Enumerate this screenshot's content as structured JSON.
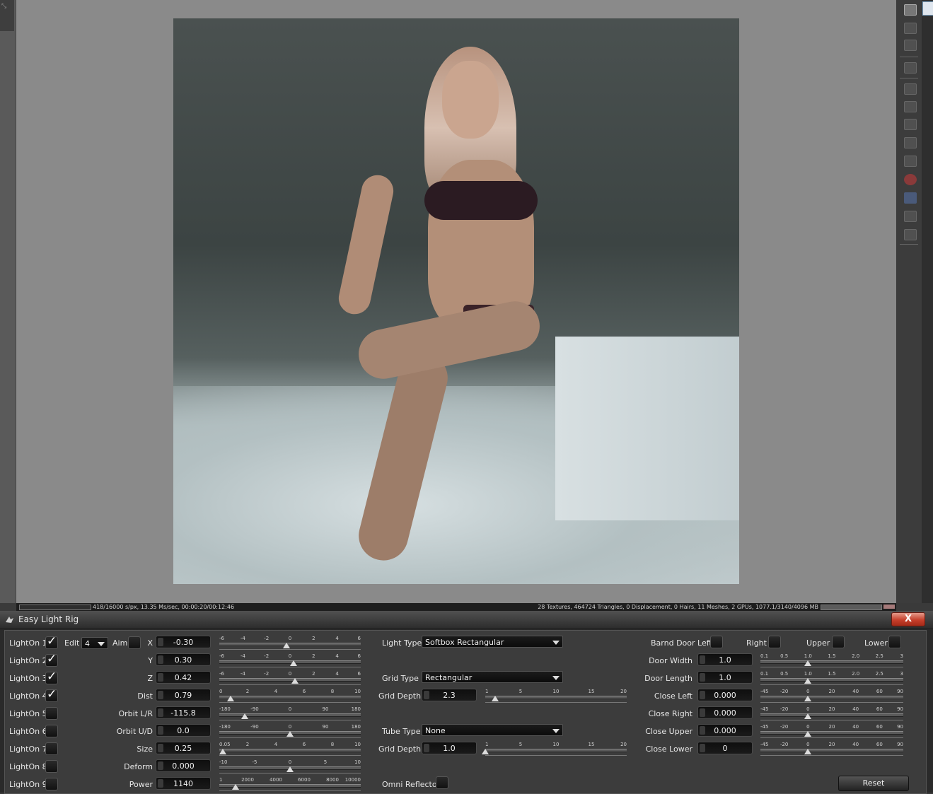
{
  "statusbar": {
    "render_stats": "418/16000 s/px, 13.35 Ms/sec, 00:00:20/00:12:46",
    "scene_stats": "28 Textures, 464724 Triangles, 0 Displacement, 0 Hairs, 11 Meshes, 2 GPUs, 1077.1/3140/4096 MB"
  },
  "dialog": {
    "title": "Easy Light Rig",
    "close_label": "X"
  },
  "lights": [
    {
      "label": "LightOn 1",
      "on": true
    },
    {
      "label": "LightOn 2",
      "on": true
    },
    {
      "label": "LightOn 3",
      "on": true
    },
    {
      "label": "LightOn 4",
      "on": true
    },
    {
      "label": "LightOn 5",
      "on": false
    },
    {
      "label": "LightOn 6",
      "on": false
    },
    {
      "label": "LightOn 7",
      "on": false
    },
    {
      "label": "LightOn 8",
      "on": false
    },
    {
      "label": "LightOn 9",
      "on": false
    }
  ],
  "edit": {
    "label": "Edit",
    "value": "4"
  },
  "aim": {
    "label": "Aim"
  },
  "params": {
    "x": {
      "label": "X",
      "value": "-0.30",
      "ticks": [
        "-6",
        "-4",
        "-2",
        "0",
        "2",
        "4",
        "6"
      ],
      "min": -6,
      "max": 6,
      "pos": -0.3
    },
    "y": {
      "label": "Y",
      "value": "0.30",
      "ticks": [
        "-6",
        "-4",
        "-2",
        "0",
        "2",
        "4",
        "6"
      ],
      "min": -6,
      "max": 6,
      "pos": 0.3
    },
    "z": {
      "label": "Z",
      "value": "0.42",
      "ticks": [
        "-6",
        "-4",
        "-2",
        "0",
        "2",
        "4",
        "6"
      ],
      "min": -6,
      "max": 6,
      "pos": 0.42
    },
    "dist": {
      "label": "Dist",
      "value": "0.79",
      "ticks": [
        "0",
        "2",
        "4",
        "6",
        "8",
        "10"
      ],
      "min": 0,
      "max": 10,
      "pos": 0.79
    },
    "orbit_lr": {
      "label": "Orbit L/R",
      "value": "-115.8",
      "ticks": [
        "-180",
        "-90",
        "0",
        "90",
        "180"
      ],
      "min": -180,
      "max": 180,
      "pos": -115.8
    },
    "orbit_ud": {
      "label": "Orbit U/D",
      "value": "0.0",
      "ticks": [
        "-180",
        "-90",
        "0",
        "90",
        "180"
      ],
      "min": -180,
      "max": 180,
      "pos": 0
    },
    "size": {
      "label": "Size",
      "value": "0.25",
      "ticks": [
        "0.05",
        "2",
        "4",
        "6",
        "8",
        "10"
      ],
      "min": 0,
      "max": 10,
      "pos": 0.25
    },
    "deform": {
      "label": "Deform",
      "value": "0.000",
      "ticks": [
        "-10",
        "-5",
        "0",
        "5",
        "10"
      ],
      "min": -10,
      "max": 10,
      "pos": 0
    },
    "power": {
      "label": "Power",
      "value": "1140",
      "ticks": [
        "1",
        "2000",
        "4000",
        "6000",
        "8000",
        "10000"
      ],
      "min": 0,
      "max": 10000,
      "pos": 1140
    }
  },
  "light_type": {
    "label": "Light Type",
    "value": "Softbox Rectangular"
  },
  "grid_type": {
    "label": "Grid  Type",
    "value": "Rectangular"
  },
  "grid_depth_1": {
    "label": "Grid  Depth",
    "value": "2.3",
    "ticks": [
      "1",
      "5",
      "10",
      "15",
      "20"
    ],
    "min": 1,
    "max": 20,
    "pos": 2.3
  },
  "tube_type": {
    "label": "Tube  Type",
    "value": "None"
  },
  "grid_depth_2": {
    "label": "Grid  Depth",
    "value": "1.0",
    "ticks": [
      "1",
      "5",
      "10",
      "15",
      "20"
    ],
    "min": 1,
    "max": 20,
    "pos": 1.0
  },
  "omni_reflector": {
    "label": "Omni Reflector"
  },
  "barn_door": {
    "left_label": "Barnd Door  Left",
    "right_label": "Right",
    "upper_label": "Upper",
    "lower_label": "Lower"
  },
  "door": {
    "width": {
      "label": "Door  Width",
      "value": "1.0",
      "ticks": [
        "0.1",
        "0.5",
        "1.0",
        "1.5",
        "2.0",
        "2.5",
        "3"
      ],
      "min": 0,
      "max": 3,
      "pos": 1.0
    },
    "length": {
      "label": "Door Length",
      "value": "1.0",
      "ticks": [
        "0.1",
        "0.5",
        "1.0",
        "1.5",
        "2.0",
        "2.5",
        "3"
      ],
      "min": 0,
      "max": 3,
      "pos": 1.0
    },
    "close_left": {
      "label": "Close   Left",
      "value": "0.000",
      "ticks": [
        "-45",
        "-20",
        "0",
        "20",
        "40",
        "60",
        "90"
      ],
      "pos": 0
    },
    "close_right": {
      "label": "Close  Right",
      "value": "0.000",
      "ticks": [
        "-45",
        "-20",
        "0",
        "20",
        "40",
        "60",
        "90"
      ],
      "pos": 0
    },
    "close_upper": {
      "label": "Close Upper",
      "value": "0.000",
      "ticks": [
        "-45",
        "-20",
        "0",
        "20",
        "40",
        "60",
        "90"
      ],
      "pos": 0
    },
    "close_lower": {
      "label": "Close Lower",
      "value": "0",
      "ticks": [
        "-45",
        "-20",
        "0",
        "20",
        "40",
        "60",
        "90"
      ],
      "pos": 0
    }
  },
  "reset_label": "Reset"
}
